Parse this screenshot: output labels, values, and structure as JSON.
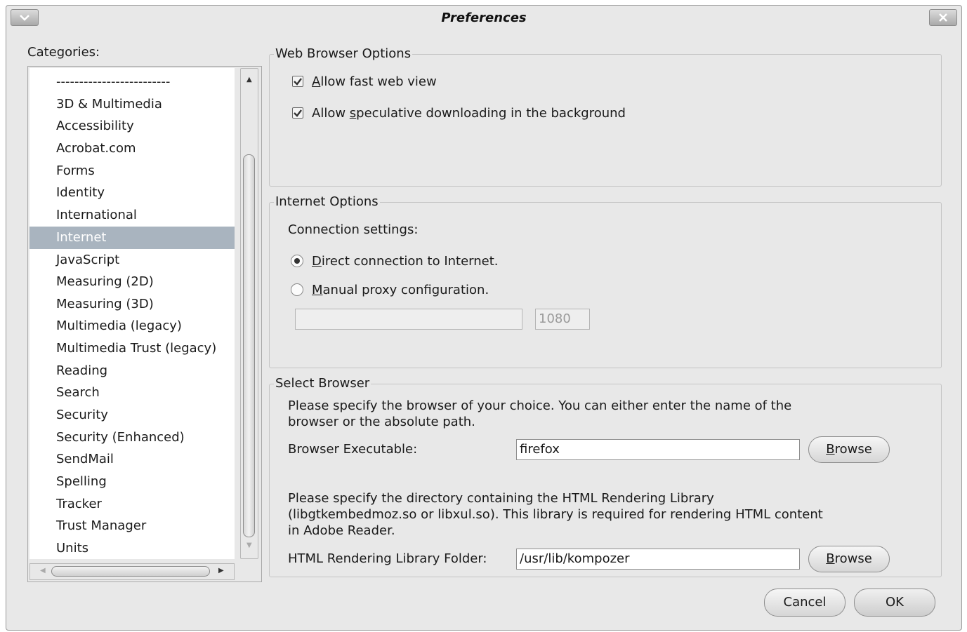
{
  "window": {
    "title": "Preferences",
    "menu_icon": "chevron-down-icon",
    "close_icon": "close-icon"
  },
  "categories": {
    "label_pre": "Cate",
    "label_ul": "g",
    "label_post": "ories:",
    "items": [
      "-------------------------",
      "3D & Multimedia",
      "Accessibility",
      "Acrobat.com",
      "Forms",
      "Identity",
      "International",
      "Internet",
      "JavaScript",
      "Measuring (2D)",
      "Measuring (3D)",
      "Multimedia (legacy)",
      "Multimedia Trust (legacy)",
      "Reading",
      "Search",
      "Security",
      "Security (Enhanced)",
      "SendMail",
      "Spelling",
      "Tracker",
      "Trust Manager",
      "Units"
    ],
    "selected": "Internet"
  },
  "web_browser_options": {
    "legend": "Web Browser Options",
    "fast_web_view": {
      "ul": "A",
      "rest": "llow fast web view",
      "checked": true
    },
    "speculative": {
      "pre": "Allow ",
      "ul": "s",
      "rest": "peculative downloading in the background",
      "checked": true
    }
  },
  "internet_options": {
    "legend": "Internet Options",
    "connection_label": "Connection settings:",
    "direct": {
      "ul": "D",
      "rest": "irect connection to Internet.",
      "selected": true
    },
    "manual": {
      "ul": "M",
      "rest": "anual proxy configuration.",
      "selected": false
    },
    "proxy_host": "",
    "proxy_port": "1080"
  },
  "select_browser": {
    "legend": "Select Browser",
    "instructions_line1": "Please specify the browser of your choice. You can either enter the name of the",
    "instructions_line2": "browser or the absolute path.",
    "executable_label": "Browser Executable:",
    "executable_value": "firefox",
    "browse_ul": "B",
    "browse_rest": "rowse",
    "library_line1": "Please specify the directory containing the HTML Rendering Library",
    "library_line2": "(libgtkembedmoz.so or libxul.so). This library is required for rendering HTML content",
    "library_line3": "in Adobe Reader.",
    "library_label": "HTML Rendering Library Folder:",
    "library_value": "/usr/lib/kompozer"
  },
  "footer": {
    "cancel": "Cancel",
    "ok": "OK"
  }
}
